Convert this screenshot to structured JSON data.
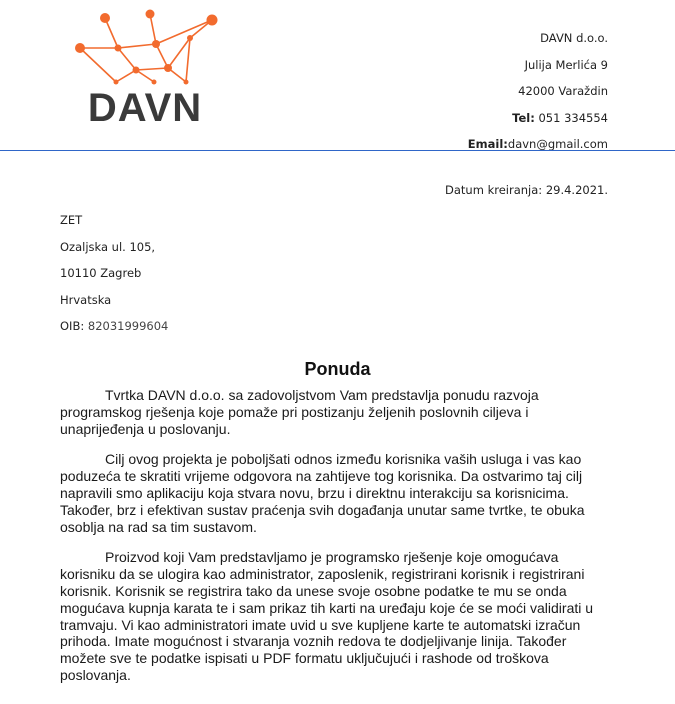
{
  "logo": {
    "text": "DAVN"
  },
  "company": {
    "name": "DAVN d.o.o.",
    "street": "Julija Merlića 9",
    "city": "42000 Varaždin",
    "tel_label": "Tel:",
    "tel_value": " 051 334554",
    "email_label": "Email:",
    "email_value": "davn@gmail.com"
  },
  "date": "Datum kreiranja: 29.4.2021.",
  "recipient": {
    "name": "ZET",
    "street": "Ozaljska ul. 105,",
    "city": "10110 Zagreb",
    "country": "Hrvatska",
    "oib_label": "OIB: ",
    "oib_value": "82031999604"
  },
  "title": "Ponuda",
  "paragraphs": [
    "Tvrtka DAVN d.o.o. sa zadovoljstvom Vam predstavlja ponudu razvoja programskog rješenja koje pomaže pri postizanju željenih poslovnih ciljeva i unaprijeđenja u poslovanju.",
    "Cilj ovog projekta je poboljšati odnos između korisnika vaših usluga i vas kao poduzeća te skratiti vrijeme odgovora na zahtijeve tog korisnika. Da ostvarimo taj cilj napravili smo aplikaciju koja stvara novu, brzu i direktnu interakciju sa korisnicima. Također, brz i efektivan sustav praćenja svih događanja unutar same tvrtke, te obuka osoblja na rad sa tim sustavom.",
    "Proizvod koji Vam predstavljamo je programsko rješenje koje omogućava korisniku da se ulogira kao administrator, zaposlenik, registrirani korisnik i registrirani korisnik. Korisnik se registrira tako da unese svoje osobne podatke te mu se onda mogućava kupnja karata te i sam prikaz tih karti na uređaju koje će se moći validirati u tramvaju. Vi kao administratori imate uvid u sve kupljene karte te automatski izračun prihoda. Imate mogućnost i stvaranja voznih redova te dodjeljivanje linija. Također možete sve te podatke ispisati u PDF formatu uključujući i rashode od troškova poslovanja."
  ],
  "colors": {
    "logo_orange": "#f26b2e",
    "logo_text": "#3a3a3a",
    "rule": "#2f66c8"
  }
}
